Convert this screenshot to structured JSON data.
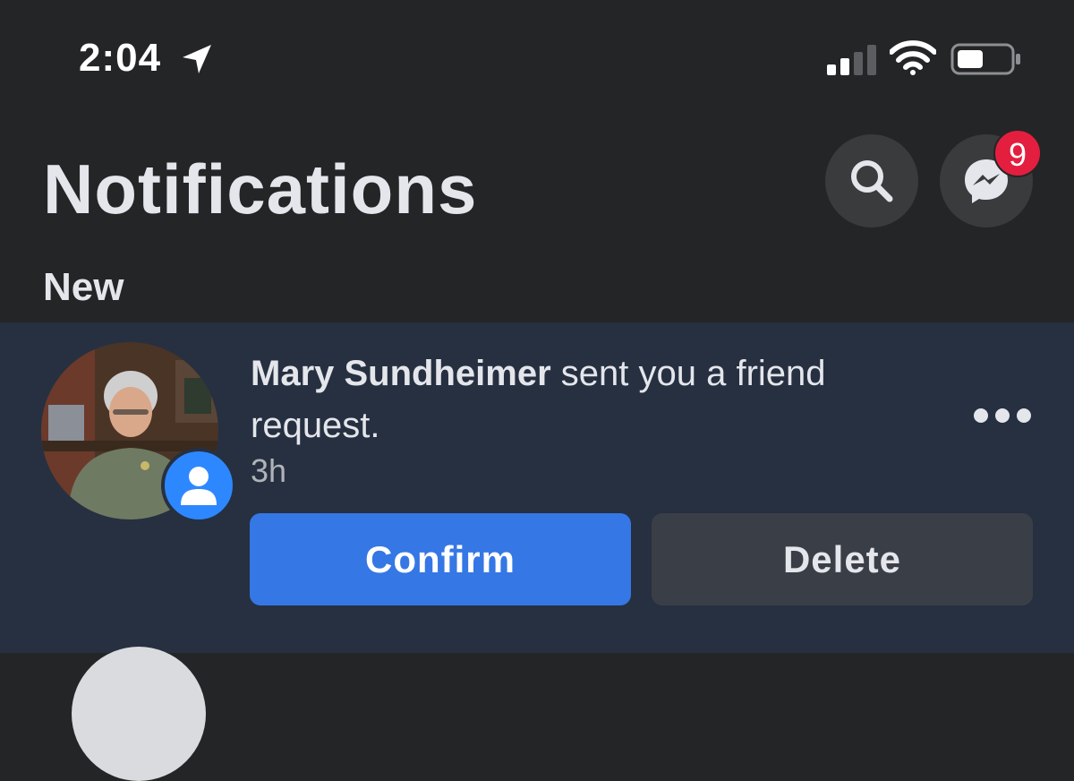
{
  "status_bar": {
    "time": "2:04",
    "location_icon": "location-arrow-icon",
    "signal_icon": "cellular-signal-icon",
    "wifi_icon": "wifi-icon",
    "battery_icon": "battery-icon"
  },
  "header": {
    "title": "Notifications",
    "search_icon": "search-icon",
    "messenger_icon": "messenger-icon",
    "messenger_badge": "9"
  },
  "section": {
    "label": "New"
  },
  "notifications": [
    {
      "name": "Mary Sundheimer",
      "message": " sent you a friend request.",
      "time": "3h",
      "badge_icon": "person-icon",
      "confirm_label": "Confirm",
      "delete_label": "Delete",
      "more_icon": "more-horizontal-icon"
    }
  ],
  "colors": {
    "background": "#242526",
    "unread_background": "#263041",
    "confirm_blue": "#3577e4",
    "badge_red": "#e41e3f",
    "friend_badge_blue": "#2d88ff"
  }
}
